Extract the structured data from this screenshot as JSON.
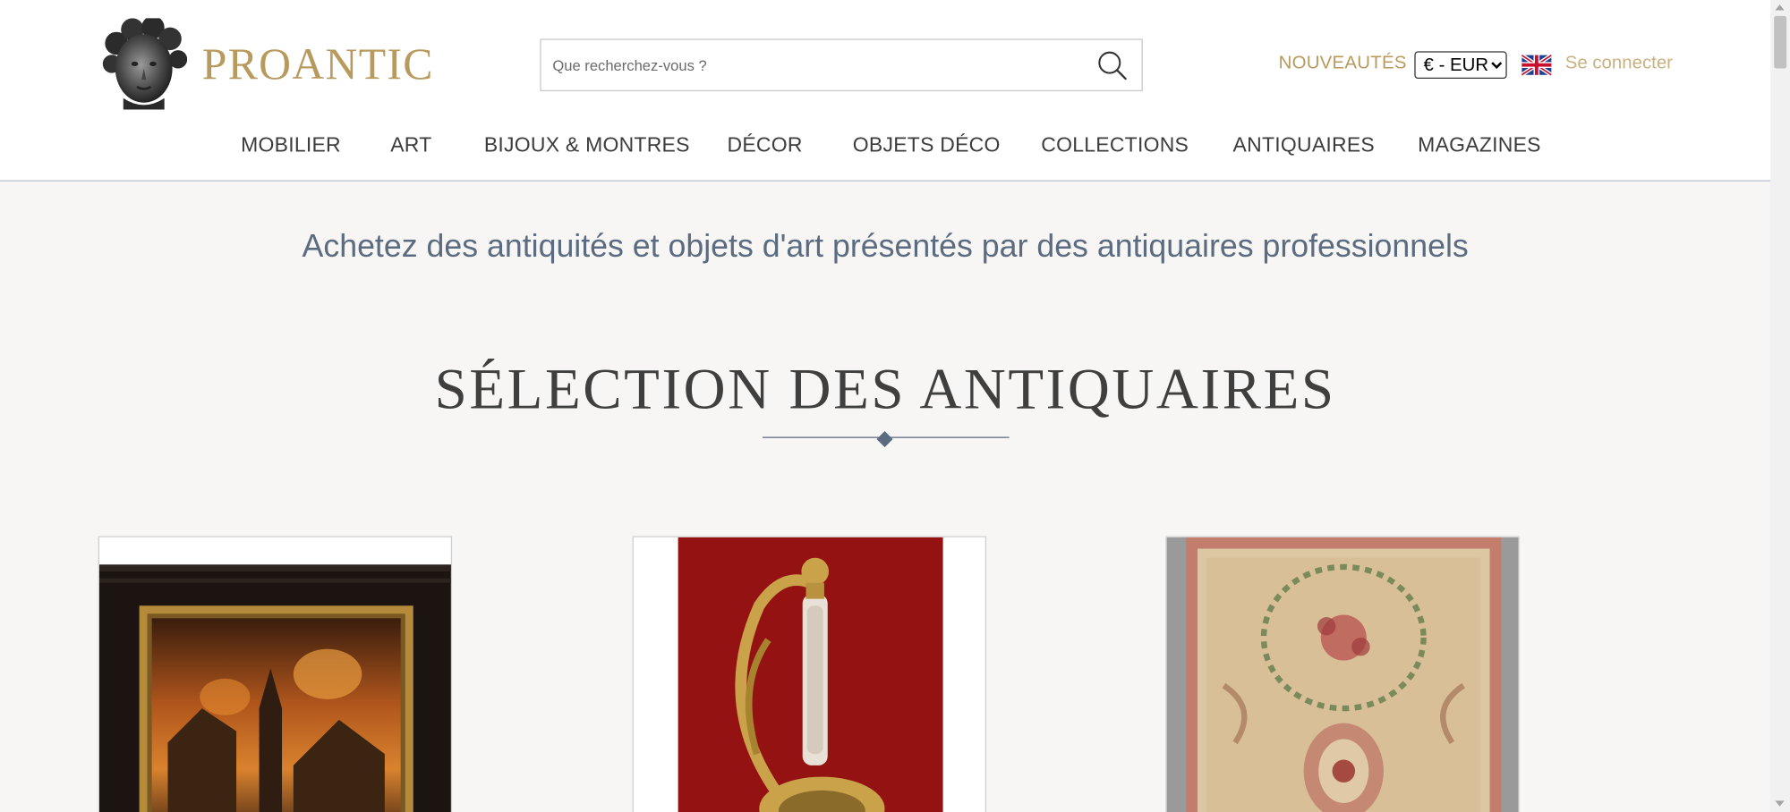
{
  "header": {
    "logo_text": "PROANTIC",
    "search_placeholder": "Que recherchez-vous ?",
    "nouveautes_label": "NOUVEAUTÉS",
    "currency_selected": "€ - EUR",
    "login_label": "Se connecter"
  },
  "nav": {
    "items": [
      {
        "label": "MOBILIER"
      },
      {
        "label": "ART"
      },
      {
        "label": "BIJOUX & MONTRES"
      },
      {
        "label": "DÉCOR"
      },
      {
        "label": "OBJETS DÉCO"
      },
      {
        "label": "COLLECTIONS"
      },
      {
        "label": "ANTIQUAIRES"
      },
      {
        "label": "MAGAZINES"
      }
    ]
  },
  "main": {
    "tagline": "Achetez des antiquités et objets d'art présentés par des antiquaires professionnels",
    "section_title": "SÉLECTION DES ANTIQUAIRES"
  },
  "colors": {
    "accent_gold": "#b89a5e",
    "slate_blue": "#5b6b80",
    "page_bg": "#f7f6f4"
  },
  "icons": {
    "search": "search-icon",
    "flag": "uk-flag-icon",
    "logo": "cherub-head-logo"
  }
}
